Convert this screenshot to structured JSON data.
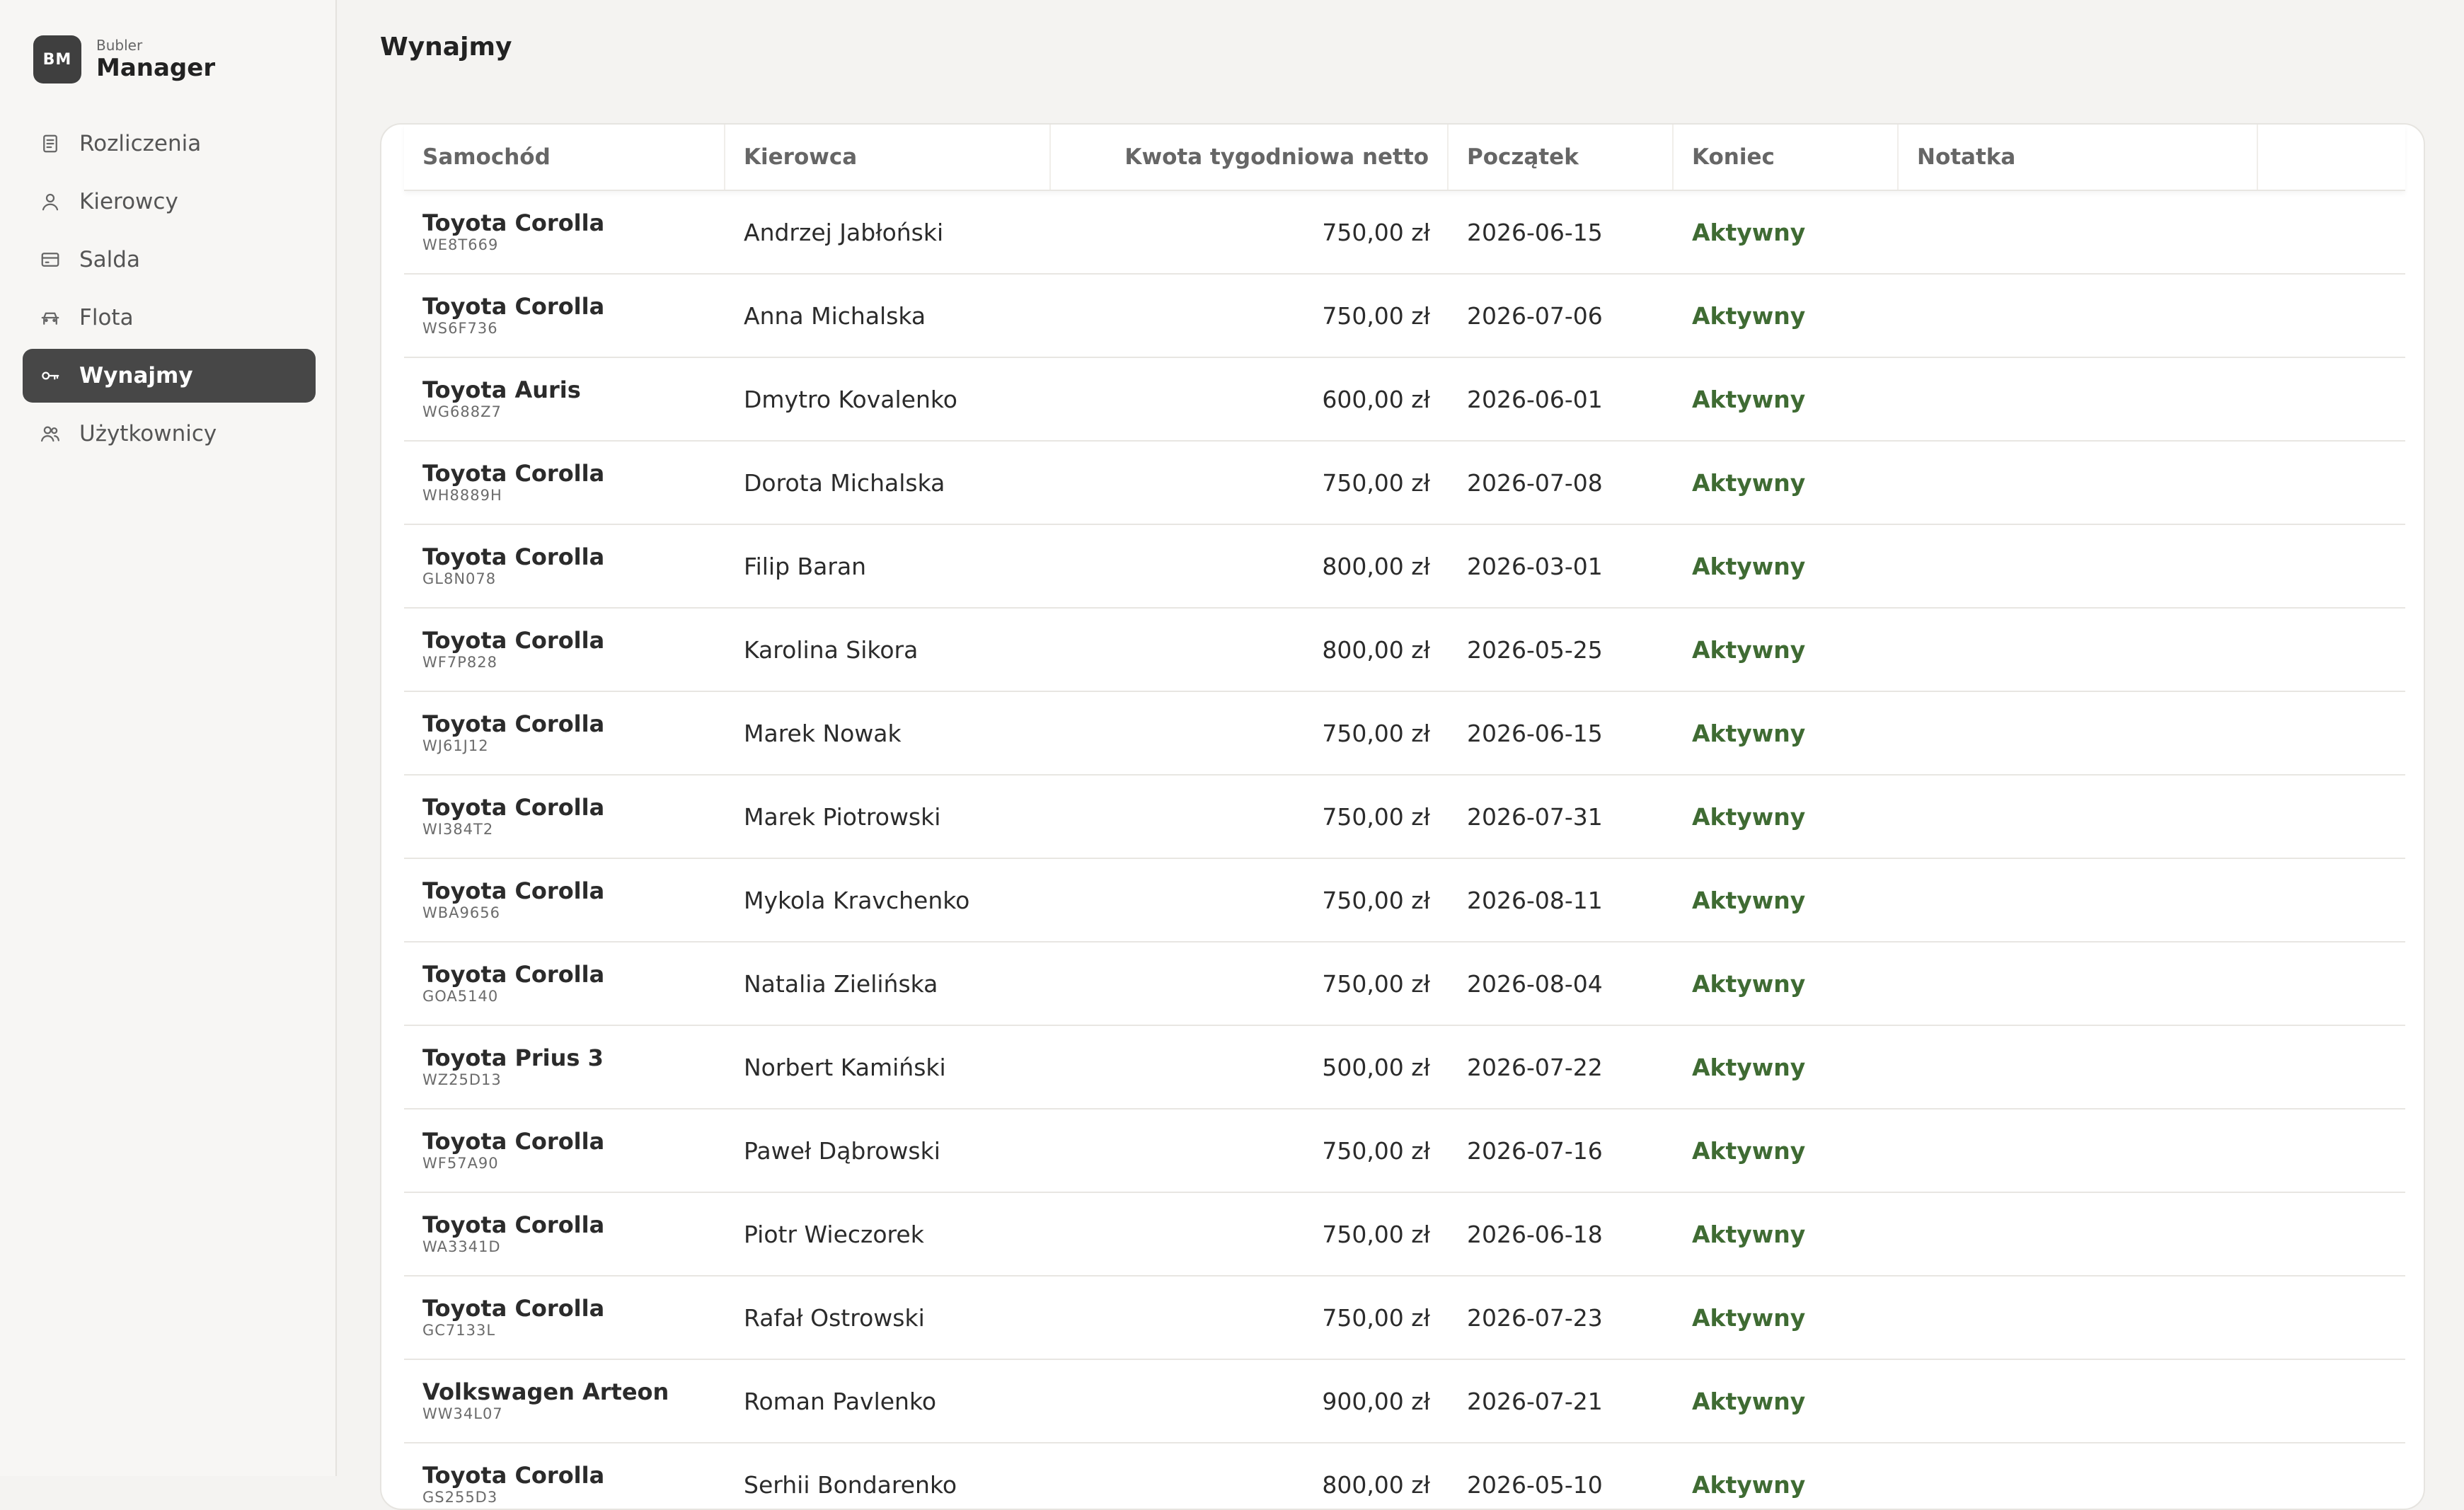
{
  "brand": {
    "logo": "BM",
    "small": "Bubler",
    "big": "Manager"
  },
  "sidebar": {
    "items": [
      {
        "label": "Rozliczenia",
        "icon": "document-icon"
      },
      {
        "label": "Kierowcy",
        "icon": "user-icon"
      },
      {
        "label": "Salda",
        "icon": "wallet-icon"
      },
      {
        "label": "Flota",
        "icon": "car-icon"
      },
      {
        "label": "Wynajmy",
        "icon": "key-icon",
        "active": true
      },
      {
        "label": "Użytkownicy",
        "icon": "users-icon"
      }
    ]
  },
  "page": {
    "title": "Wynajmy"
  },
  "table": {
    "headers": {
      "car": "Samochód",
      "driver": "Kierowca",
      "amount": "Kwota tygodniowa netto",
      "start": "Początek",
      "end": "Koniec",
      "note": "Notatka"
    },
    "rows": [
      {
        "car": "Toyota Corolla",
        "plate": "WE8T669",
        "driver": "Andrzej Jabłoński",
        "amount": "750,00 zł",
        "start": "2026-06-15",
        "status": "Aktywny"
      },
      {
        "car": "Toyota Corolla",
        "plate": "WS6F736",
        "driver": "Anna Michalska",
        "amount": "750,00 zł",
        "start": "2026-07-06",
        "status": "Aktywny"
      },
      {
        "car": "Toyota Auris",
        "plate": "WG688Z7",
        "driver": "Dmytro Kovalenko",
        "amount": "600,00 zł",
        "start": "2026-06-01",
        "status": "Aktywny"
      },
      {
        "car": "Toyota Corolla",
        "plate": "WH8889H",
        "driver": "Dorota Michalska",
        "amount": "750,00 zł",
        "start": "2026-07-08",
        "status": "Aktywny"
      },
      {
        "car": "Toyota Corolla",
        "plate": "GL8N078",
        "driver": "Filip Baran",
        "amount": "800,00 zł",
        "start": "2026-03-01",
        "status": "Aktywny"
      },
      {
        "car": "Toyota Corolla",
        "plate": "WF7P828",
        "driver": "Karolina Sikora",
        "amount": "800,00 zł",
        "start": "2026-05-25",
        "status": "Aktywny"
      },
      {
        "car": "Toyota Corolla",
        "plate": "WJ61J12",
        "driver": "Marek Nowak",
        "amount": "750,00 zł",
        "start": "2026-06-15",
        "status": "Aktywny"
      },
      {
        "car": "Toyota Corolla",
        "plate": "WI384T2",
        "driver": "Marek Piotrowski",
        "amount": "750,00 zł",
        "start": "2026-07-31",
        "status": "Aktywny"
      },
      {
        "car": "Toyota Corolla",
        "plate": "WBA9656",
        "driver": "Mykola Kravchenko",
        "amount": "750,00 zł",
        "start": "2026-08-11",
        "status": "Aktywny"
      },
      {
        "car": "Toyota Corolla",
        "plate": "GOA5140",
        "driver": "Natalia Zielińska",
        "amount": "750,00 zł",
        "start": "2026-08-04",
        "status": "Aktywny"
      },
      {
        "car": "Toyota Prius 3",
        "plate": "WZ25D13",
        "driver": "Norbert Kamiński",
        "amount": "500,00 zł",
        "start": "2026-07-22",
        "status": "Aktywny"
      },
      {
        "car": "Toyota Corolla",
        "plate": "WF57A90",
        "driver": "Paweł Dąbrowski",
        "amount": "750,00 zł",
        "start": "2026-07-16",
        "status": "Aktywny"
      },
      {
        "car": "Toyota Corolla",
        "plate": "WA3341D",
        "driver": "Piotr Wieczorek",
        "amount": "750,00 zł",
        "start": "2026-06-18",
        "status": "Aktywny"
      },
      {
        "car": "Toyota Corolla",
        "plate": "GC7133L",
        "driver": "Rafał Ostrowski",
        "amount": "750,00 zł",
        "start": "2026-07-23",
        "status": "Aktywny"
      },
      {
        "car": "Volkswagen Arteon",
        "plate": "WW34L07",
        "driver": "Roman Pavlenko",
        "amount": "900,00 zł",
        "start": "2026-07-21",
        "status": "Aktywny"
      },
      {
        "car": "Toyota Corolla",
        "plate": "GS255D3",
        "driver": "Serhii Bondarenko",
        "amount": "800,00 zł",
        "start": "2026-05-10",
        "status": "Aktywny"
      }
    ]
  },
  "colors": {
    "active_status": "#3f6b33",
    "nav_active_bg": "#474747",
    "page_bg": "#f4f3f1"
  }
}
